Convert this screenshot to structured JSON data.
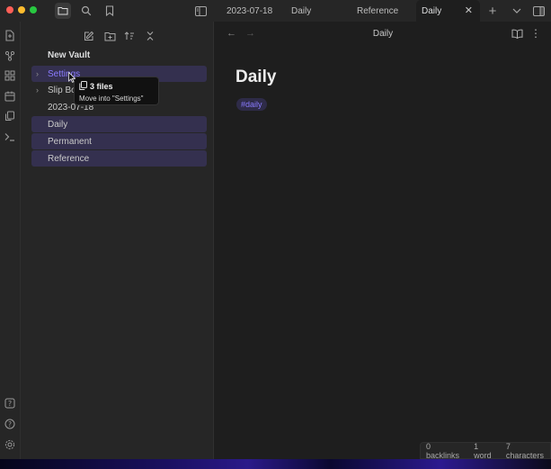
{
  "titlebar": {
    "tabs": [
      {
        "label": "2023-07-18"
      },
      {
        "label": "Daily"
      },
      {
        "label": "Reference"
      },
      {
        "label": "Daily",
        "active": true
      }
    ],
    "close_glyph": "✕",
    "new_tab_glyph": "+",
    "tab_list_glyph": "⌄"
  },
  "sidebar": {
    "vault_name": "New Vault",
    "items": [
      {
        "label": "Settings",
        "type": "folder",
        "state": "drop-target"
      },
      {
        "label": "Slip Box",
        "type": "folder"
      },
      {
        "label": "2023-07-18",
        "type": "file"
      },
      {
        "label": "Daily",
        "type": "file",
        "selected": true
      },
      {
        "label": "Permanent",
        "type": "file",
        "selected": true
      },
      {
        "label": "Reference",
        "type": "file",
        "selected": true
      }
    ],
    "tree_chevron": "›"
  },
  "tooltip": {
    "title": "3 files",
    "subtitle": "Move into \"Settings\""
  },
  "main": {
    "view_title": "Daily",
    "back_glyph": "←",
    "forward_glyph": "→",
    "more_glyph": "⋮",
    "doc_title": "Daily",
    "tag": "#daily"
  },
  "status": {
    "backlinks": "0 backlinks",
    "words": "1 word",
    "characters": "7 characters"
  },
  "colors": {
    "accent": "#8a7bff",
    "selection_bg": "#34304f",
    "close_red": "#ff5f57",
    "minimize_yellow": "#febc2e",
    "zoom_green": "#28c840"
  }
}
